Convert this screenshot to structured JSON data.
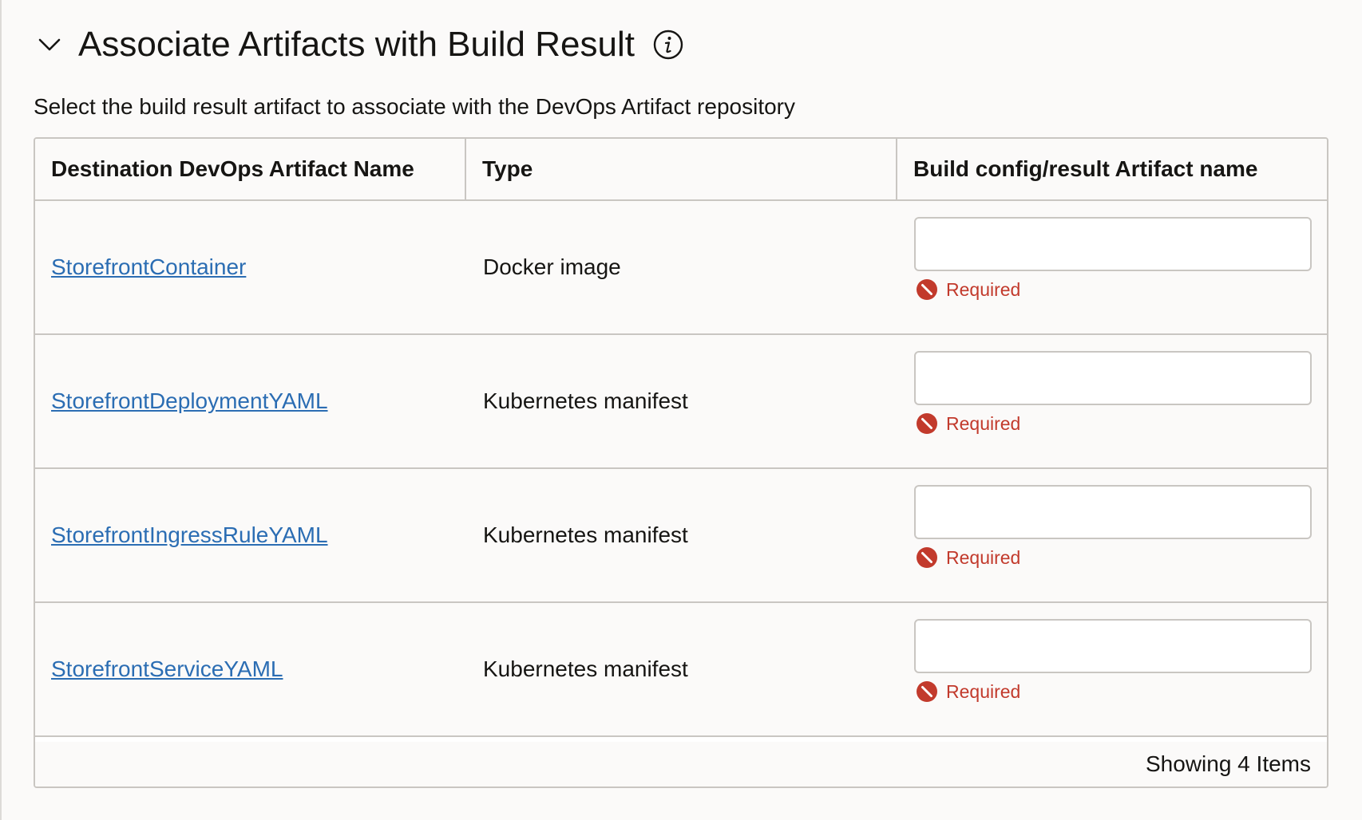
{
  "section": {
    "title": "Associate Artifacts with Build Result",
    "description": "Select the build result artifact to associate with the DevOps Artifact repository",
    "icons": {
      "collapse": "chevron-down-icon",
      "info": "info-icon"
    }
  },
  "table": {
    "columns": [
      "Destination DevOps Artifact Name",
      "Type",
      "Build config/result Artifact name"
    ],
    "rows": [
      {
        "name": "StorefrontContainer",
        "type": "Docker image",
        "value": "",
        "error": "Required"
      },
      {
        "name": "StorefrontDeploymentYAML",
        "type": "Kubernetes manifest",
        "value": "",
        "error": "Required"
      },
      {
        "name": "StorefrontIngressRuleYAML",
        "type": "Kubernetes manifest",
        "value": "",
        "error": "Required"
      },
      {
        "name": "StorefrontServiceYAML",
        "type": "Kubernetes manifest",
        "value": "",
        "error": "Required"
      }
    ],
    "footer": "Showing 4 Items"
  },
  "colors": {
    "link": "#2b6db3",
    "error": "#c23a2c",
    "border": "#c9c6c2"
  }
}
